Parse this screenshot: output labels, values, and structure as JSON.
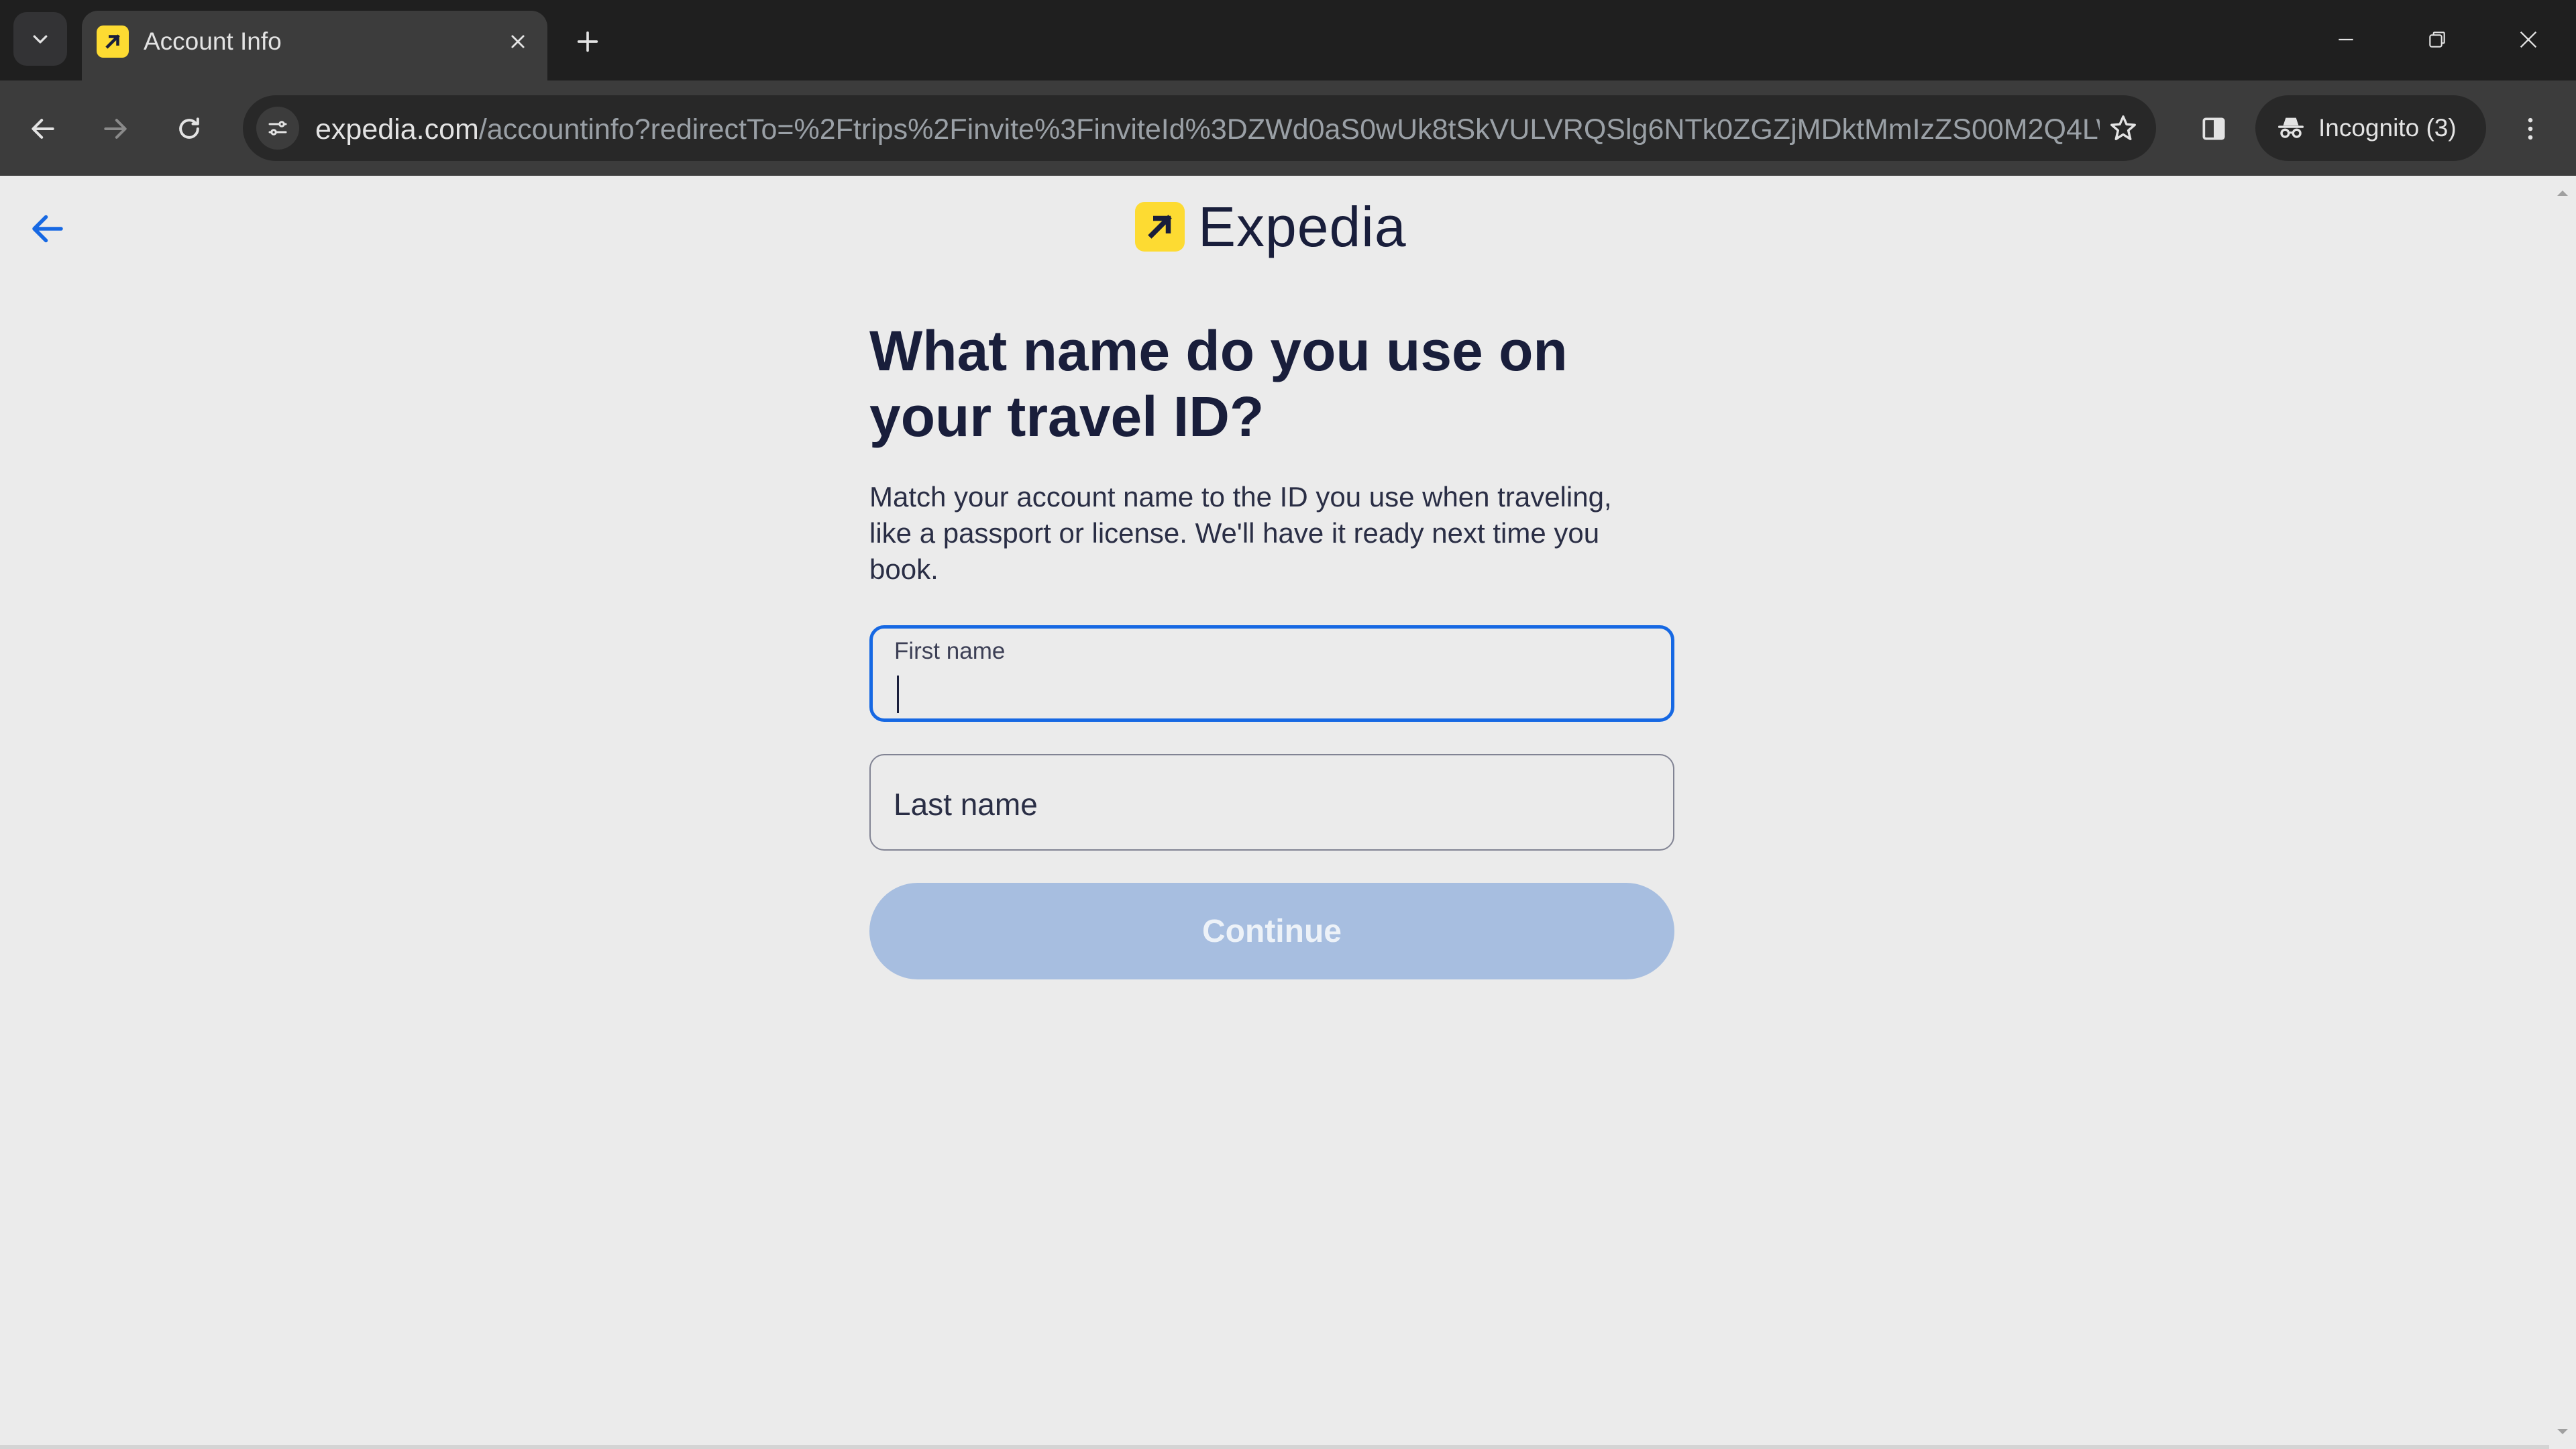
{
  "browser": {
    "tab": {
      "title": "Account Info"
    },
    "address_bar": {
      "host": "expedia.com",
      "path": "/accountinfo?redirectTo=%2Ftrips%2Finvite%3FinviteId%3DZWd0aS0wUk8tSkVULVRQSlg6NTk0ZGZjMDktMmIzZS00M2Q4LWI2..."
    },
    "incognito_label": "Incognito (3)",
    "icons": {
      "tab_search": "chevron-down-icon",
      "favicon": "expedia-favicon",
      "close": "close-icon",
      "new_tab": "plus-icon",
      "back": "arrow-left-icon",
      "forward": "arrow-right-icon",
      "reload": "reload-icon",
      "site_info": "tune-icon",
      "bookmark": "star-icon",
      "side_panel": "side-panel-icon",
      "incognito": "incognito-icon",
      "menu": "kebab-menu-icon",
      "minimize": "minimize-icon",
      "restore": "restore-icon",
      "window_close": "window-close-icon"
    }
  },
  "page": {
    "logo_text": "Expedia",
    "heading": "What name do you use on your travel ID?",
    "subtext": "Match your account name to the ID you use when traveling, like a passport or license. We'll have it ready next time you book.",
    "first_name": {
      "label": "First name",
      "value": ""
    },
    "last_name": {
      "label": "Last name",
      "value": ""
    },
    "continue_label": "Continue",
    "colors": {
      "brand_yellow": "#fddb32",
      "brand_navy": "#191e3b",
      "focus_blue": "#1668e3",
      "button_disabled": "#a7bee0"
    }
  }
}
